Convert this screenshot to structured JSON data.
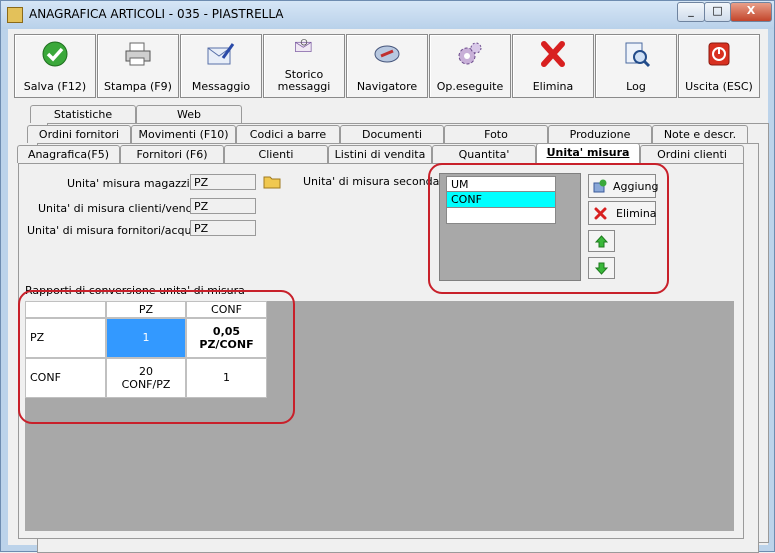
{
  "window": {
    "title": "ANAGRAFICA ARTICOLI - 035 - PIASTRELLA",
    "btn_min": "_",
    "btn_max": "□",
    "btn_close": "X"
  },
  "toolbar": {
    "items": [
      {
        "label": "Salva (F12)",
        "icon": "checkmark-icon"
      },
      {
        "label": "Stampa (F9)",
        "icon": "printer-icon"
      },
      {
        "label": "Messaggio",
        "icon": "envelope-pen-icon"
      },
      {
        "label": "Storico\nmessaggi",
        "icon": "envelope-search-icon"
      },
      {
        "label": "Navigatore",
        "icon": "compass-icon"
      },
      {
        "label": "Op.eseguite",
        "icon": "gears-icon"
      },
      {
        "label": "Elimina",
        "icon": "red-x-icon"
      },
      {
        "label": "Log",
        "icon": "magnifier-log-icon"
      },
      {
        "label": "Uscita (ESC)",
        "icon": "power-icon"
      }
    ]
  },
  "tabs": {
    "row1": [
      "Statistiche",
      "Web"
    ],
    "row2": [
      "Ordini fornitori",
      "Movimenti (F10)",
      "Codici a barre",
      "Documenti",
      "Foto",
      "Produzione",
      "Note e descr."
    ],
    "row3": [
      "Anagrafica(F5)",
      "Fornitori (F6)",
      "Clienti",
      "Listini di vendita",
      "Quantita'",
      "Unita' misura",
      "Ordini clienti"
    ],
    "active": "Unita' misura"
  },
  "units": {
    "magazzino_label": "Unita' misura magazzino :",
    "magazzino_value": "PZ",
    "clienti_label": "Unita' di misura clienti/vendita :",
    "clienti_value": "PZ",
    "fornitori_label": "Unita' di misura fornitori/acquisto :",
    "fornitori_value": "PZ",
    "secondary_label": "Unita' di misura secondarie :",
    "secondary_header": "UM",
    "secondary_items": [
      "CONF"
    ],
    "add_button": "Aggiung",
    "delete_button": "Elimina"
  },
  "conversion": {
    "title": "Rapporti di conversione unita' di misura",
    "columns": [
      "PZ",
      "CONF"
    ],
    "rows": [
      {
        "label": "PZ",
        "cells": [
          "1",
          "0,05\nPZ/CONF"
        ]
      },
      {
        "label": "CONF",
        "cells": [
          "20\nCONF/PZ",
          "1"
        ]
      }
    ]
  },
  "colors": {
    "highlight_ring": "#c8202a",
    "selected_row": "#00ffff",
    "selected_cell": "#3399ff"
  }
}
